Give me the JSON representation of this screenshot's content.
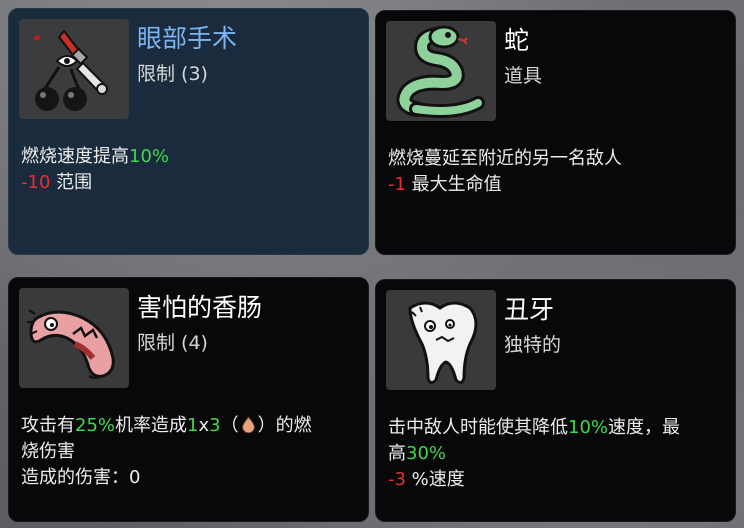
{
  "cards": [
    {
      "title": "眼部手术",
      "tag": "限制 (3)",
      "line1": {
        "text": "燃烧速度提高",
        "value": "10%"
      },
      "line2": {
        "value": "-10",
        "text": " 范围"
      },
      "icon": "eye-surgery-icon"
    },
    {
      "title": "蛇",
      "tag": "道具",
      "line1": {
        "text": "燃烧蔓延至附近的另一名敌人"
      },
      "line2": {
        "value": "-1",
        "text": " 最大生命值"
      },
      "icon": "snake-icon"
    },
    {
      "title": "害怕的香肠",
      "tag": "限制 (4)",
      "line1": {
        "t1": "攻击有",
        "v1": "25%",
        "t2": "机率造成",
        "v2": "1",
        "t3": "x",
        "v3": "3",
        "t4": "（",
        "t5": "）的燃"
      },
      "line1b": "烧伤害",
      "line2": "造成的伤害：0",
      "icon": "scared-sausage-icon"
    },
    {
      "title": "丑牙",
      "tag": "独特的",
      "line1": {
        "t1": "击中敌人时能使其降低",
        "v1": "10%",
        "t2": "速度，最"
      },
      "line1b": {
        "t1": "高",
        "v1": "30%"
      },
      "line2": {
        "value": "-3",
        "text": " %速度"
      },
      "icon": "ugly-tooth-icon"
    }
  ],
  "colors": {
    "positive": "#3fd84a",
    "negative": "#ee2e2e",
    "selected_title": "#7cb3f0"
  }
}
